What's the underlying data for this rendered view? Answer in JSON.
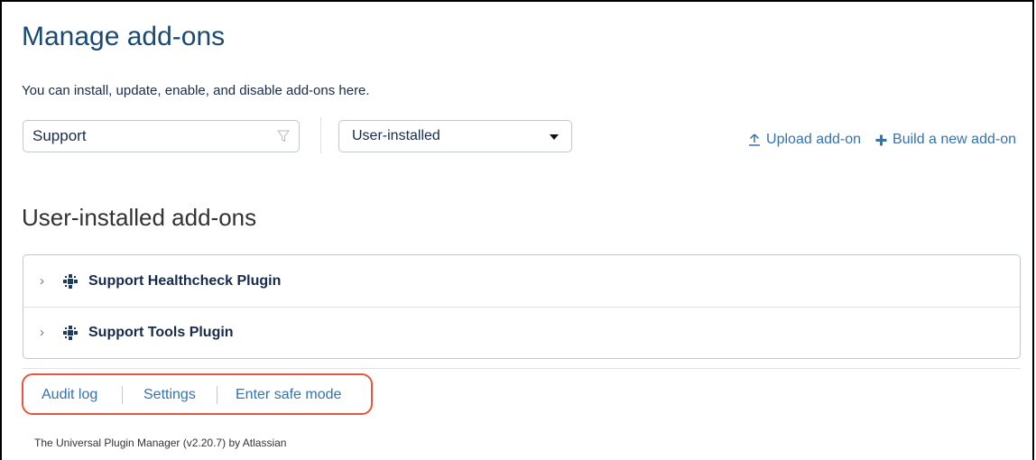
{
  "page": {
    "title": "Manage add-ons",
    "description": "You can install, update, enable, and disable add-ons here."
  },
  "filter": {
    "value": "Support",
    "icon": "funnel-icon"
  },
  "type_select": {
    "selected": "User-installed"
  },
  "actions": {
    "upload_label": "Upload add-on",
    "build_label": "Build a new add-on"
  },
  "section": {
    "title": "User-installed add-ons",
    "addons": [
      {
        "name": "Support Healthcheck Plugin",
        "icon": "plugin-icon"
      },
      {
        "name": "Support Tools Plugin",
        "icon": "plugin-icon"
      }
    ]
  },
  "footer": {
    "links": [
      "Audit log",
      "Settings",
      "Enter safe mode"
    ],
    "credit": "The Universal Plugin Manager (v2.20.7) by Atlassian"
  },
  "colors": {
    "link": "#3572b0",
    "title": "#1a4a73",
    "highlight": "#e8553e"
  }
}
